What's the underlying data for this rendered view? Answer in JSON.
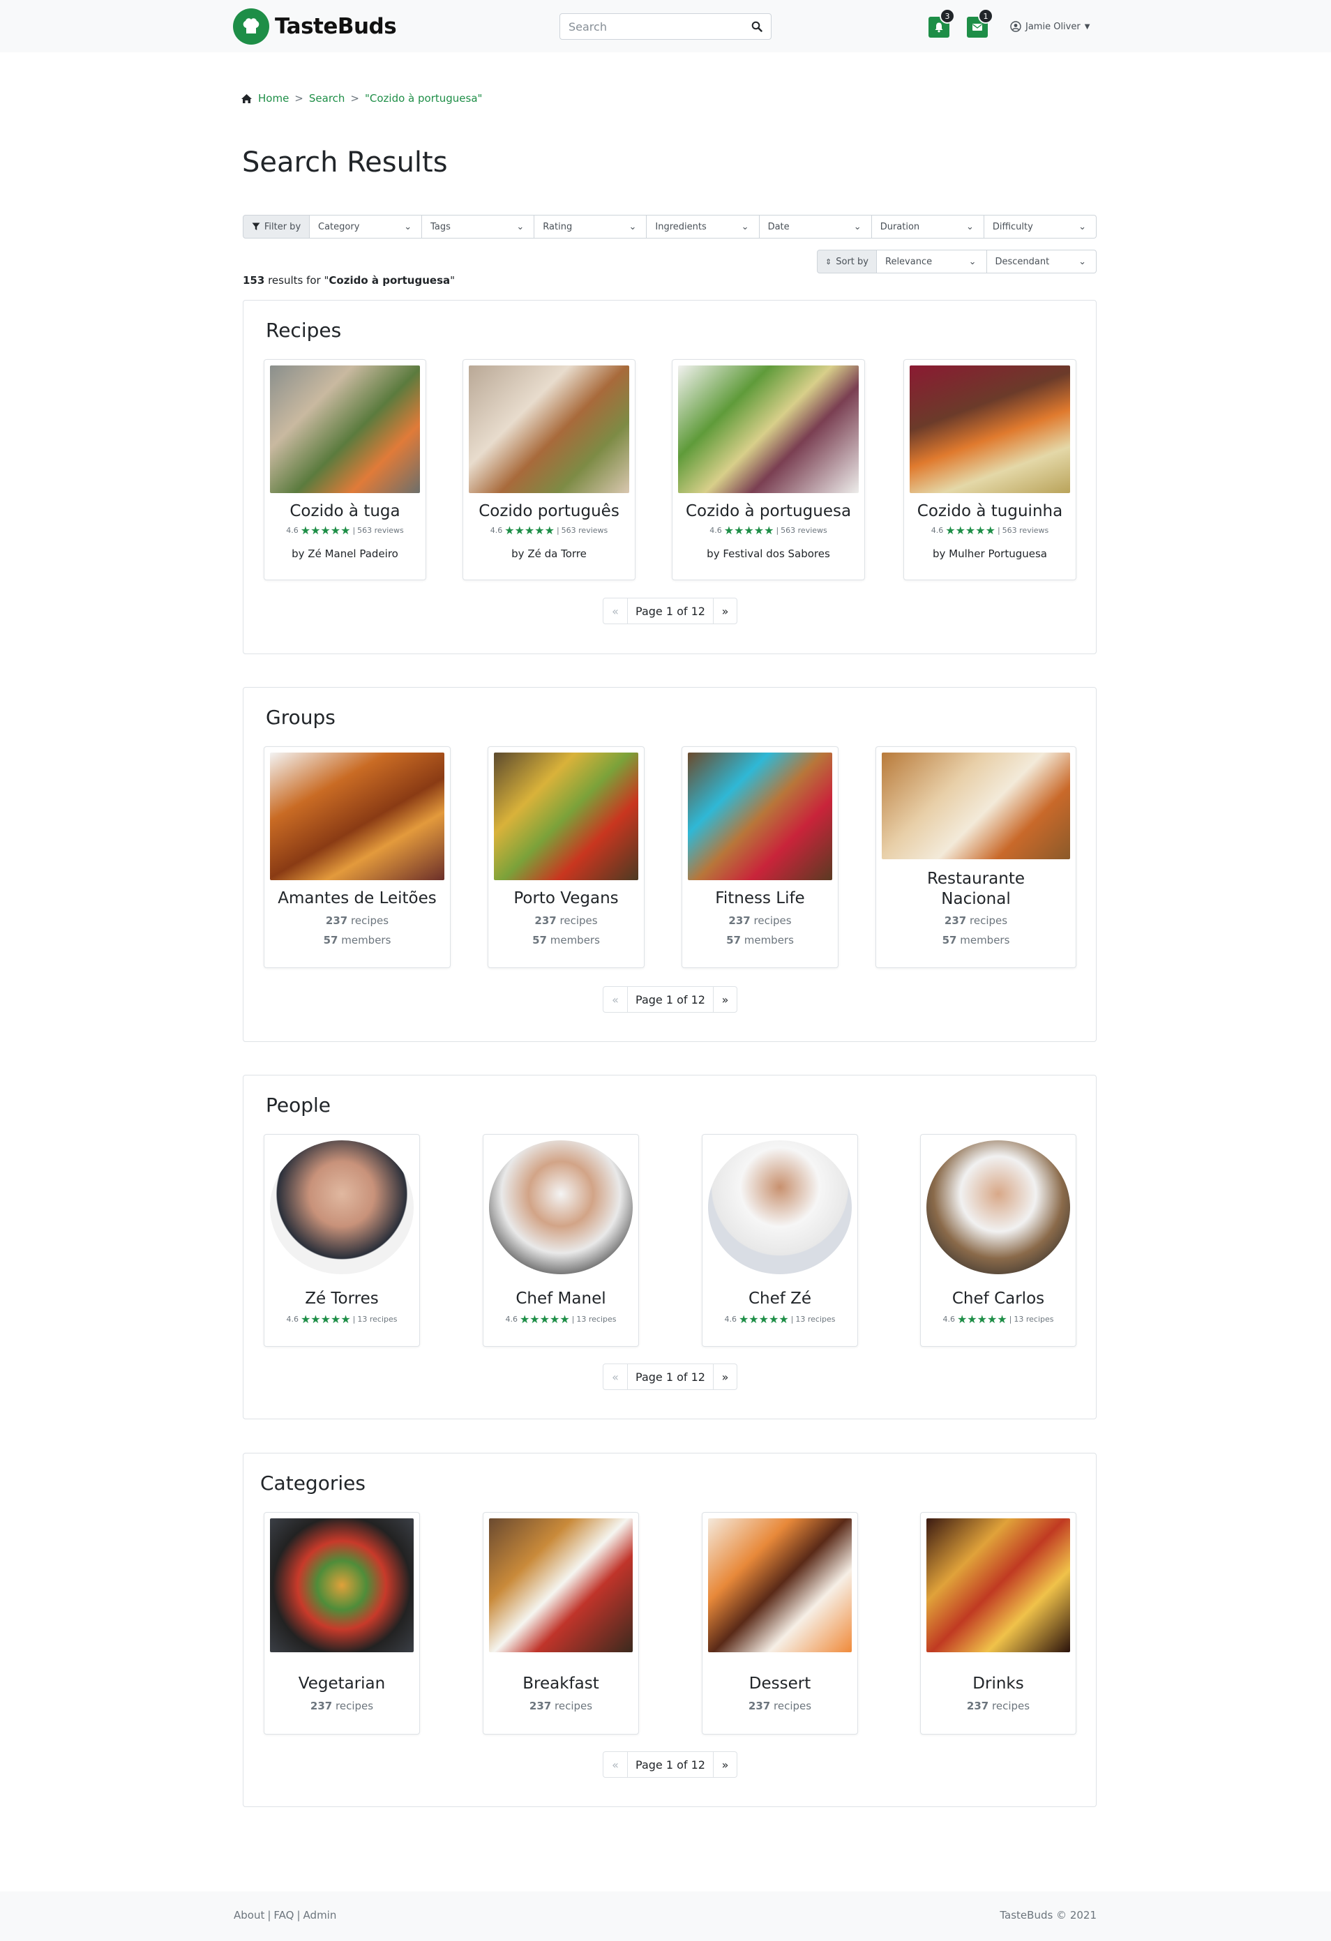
{
  "navbar": {
    "brand": "TasteBuds",
    "search_placeholder": "Search",
    "notifications_count": "3",
    "messages_count": "1",
    "user_name": "Jamie Oliver",
    "accent": "#1e8e47"
  },
  "breadcrumb": {
    "home": "Home",
    "search": "Search",
    "query": "\"Cozido à portuguesa\"",
    "sep": ">"
  },
  "page_title": "Search Results",
  "filters": {
    "label": "Filter by",
    "items": [
      "Category",
      "Tags",
      "Rating",
      "Ingredients",
      "Date",
      "Duration",
      "Difficulty"
    ]
  },
  "sort": {
    "label": "Sort by",
    "field": "Relevance",
    "order": "Descendant"
  },
  "results": {
    "count": "153",
    "text_before": " results for \"",
    "query": "Cozido à portuguesa",
    "text_after": "\""
  },
  "recipes": {
    "title": "Recipes",
    "items": [
      {
        "name": "Cozido à tuga",
        "rating": "4.6",
        "reviews": "563 reviews",
        "author": "by Zé Manel Padeiro"
      },
      {
        "name": "Cozido português",
        "rating": "4.6",
        "reviews": "563 reviews",
        "author": "by Zé da Torre"
      },
      {
        "name": "Cozido à portuguesa",
        "rating": "4.6",
        "reviews": "563 reviews",
        "author": "by Festival dos Sabores"
      },
      {
        "name": "Cozido à tuguinha",
        "rating": "4.6",
        "reviews": "563 reviews",
        "author": "by Mulher Portuguesa"
      }
    ],
    "pager": "Page 1 of 12"
  },
  "groups": {
    "title": "Groups",
    "items": [
      {
        "name": "Amantes de Leitões",
        "recipes_count": "237",
        "recipes_label": "recipes",
        "members_count": "57",
        "members_label": "members"
      },
      {
        "name": "Porto Vegans",
        "recipes_count": "237",
        "recipes_label": "recipes",
        "members_count": "57",
        "members_label": "members"
      },
      {
        "name": "Fitness Life",
        "recipes_count": "237",
        "recipes_label": "recipes",
        "members_count": "57",
        "members_label": "members"
      },
      {
        "name_line1": "Restaurante",
        "name_line2": "Nacional",
        "recipes_count": "237",
        "recipes_label": "recipes",
        "members_count": "57",
        "members_label": "members"
      }
    ],
    "pager": "Page 1 of 12"
  },
  "people": {
    "title": "People",
    "items": [
      {
        "name": "Zé Torres",
        "rating": "4.6",
        "recipes": "13 recipes"
      },
      {
        "name": "Chef Manel",
        "rating": "4.6",
        "recipes": "13 recipes"
      },
      {
        "name": "Chef Zé",
        "rating": "4.6",
        "recipes": "13 recipes"
      },
      {
        "name": "Chef Carlos",
        "rating": "4.6",
        "recipes": "13 recipes"
      }
    ],
    "pager": "Page 1 of 12"
  },
  "categories": {
    "title": "Categories",
    "items": [
      {
        "name": "Vegetarian",
        "recipes_count": "237",
        "recipes_label": "recipes"
      },
      {
        "name": "Breakfast",
        "recipes_count": "237",
        "recipes_label": "recipes"
      },
      {
        "name": "Dessert",
        "recipes_count": "237",
        "recipes_label": "recipes"
      },
      {
        "name": "Drinks",
        "recipes_count": "237",
        "recipes_label": "recipes"
      }
    ],
    "pager": "Page 1 of 12"
  },
  "pager_prev": "«",
  "pager_next": "»",
  "stars": "★★★★★",
  "footer": {
    "about": "About",
    "faq": "FAQ",
    "admin": "Admin",
    "sep": "|",
    "copyright": "TasteBuds © 2021"
  }
}
